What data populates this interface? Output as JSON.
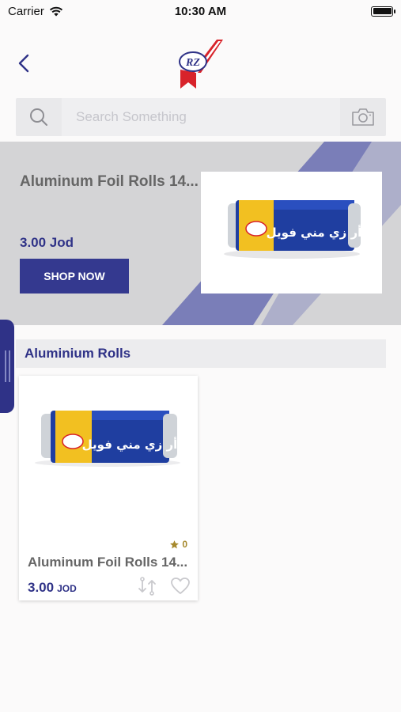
{
  "status_bar": {
    "carrier": "Carrier",
    "time": "10:30 AM"
  },
  "header": {
    "logo_text": "RZ"
  },
  "search": {
    "placeholder": "Search Something",
    "value": ""
  },
  "banner": {
    "title": "Aluminum Foil Rolls 14...",
    "price": "3.00 Jod",
    "button_label": "SHOP NOW",
    "package_text": "أر زي مني فويل"
  },
  "section": {
    "title": "Aluminium Rolls"
  },
  "products": [
    {
      "name": "Aluminum Foil Rolls 14...",
      "price": "3.00",
      "currency": "JOD",
      "rating": "0",
      "package_text": "أر زي مني فويل"
    }
  ],
  "colors": {
    "primary": "#2f3287",
    "banner_bg": "#d4d4d6",
    "star": "#a6892d",
    "logo_red": "#d8232a"
  }
}
